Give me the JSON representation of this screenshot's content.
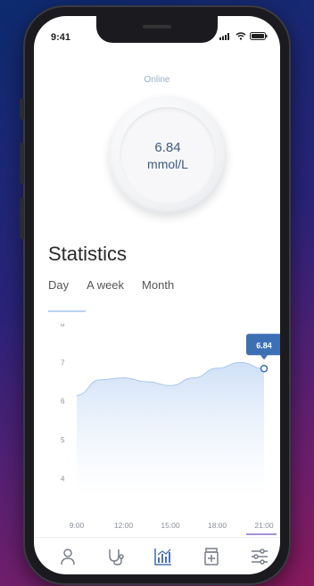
{
  "status_bar": {
    "time": "9:41"
  },
  "connection_status": "Online",
  "reading": {
    "value": "6.84",
    "unit": "mmol/L"
  },
  "statistics": {
    "title": "Statistics",
    "tabs": [
      {
        "label": "Day",
        "active": true
      },
      {
        "label": "A week",
        "active": false
      },
      {
        "label": "Month",
        "active": false
      }
    ]
  },
  "chart_data": {
    "type": "area",
    "x": [
      "9:00",
      "12:00",
      "15:00",
      "18:00",
      "21:00"
    ],
    "yticks": [
      "8",
      "7",
      "6",
      "5",
      "4"
    ],
    "ylim": [
      3.5,
      8
    ],
    "points": [
      [
        0,
        6.15
      ],
      [
        0.5,
        6.55
      ],
      [
        1,
        6.6
      ],
      [
        1.5,
        6.5
      ],
      [
        2,
        6.4
      ],
      [
        2.5,
        6.6
      ],
      [
        3,
        6.85
      ],
      [
        3.5,
        7.0
      ],
      [
        4,
        6.84
      ]
    ],
    "tooltip": "6.84",
    "grid": false,
    "accent": "#3d6fb5",
    "fill": "#cfe0f7"
  },
  "bottom_nav": [
    {
      "icon": "user-icon",
      "active": false
    },
    {
      "icon": "stethoscope-icon",
      "active": false
    },
    {
      "icon": "chart-icon",
      "active": true
    },
    {
      "icon": "medicine-icon",
      "active": false
    },
    {
      "icon": "settings-sliders-icon",
      "active": false
    }
  ]
}
